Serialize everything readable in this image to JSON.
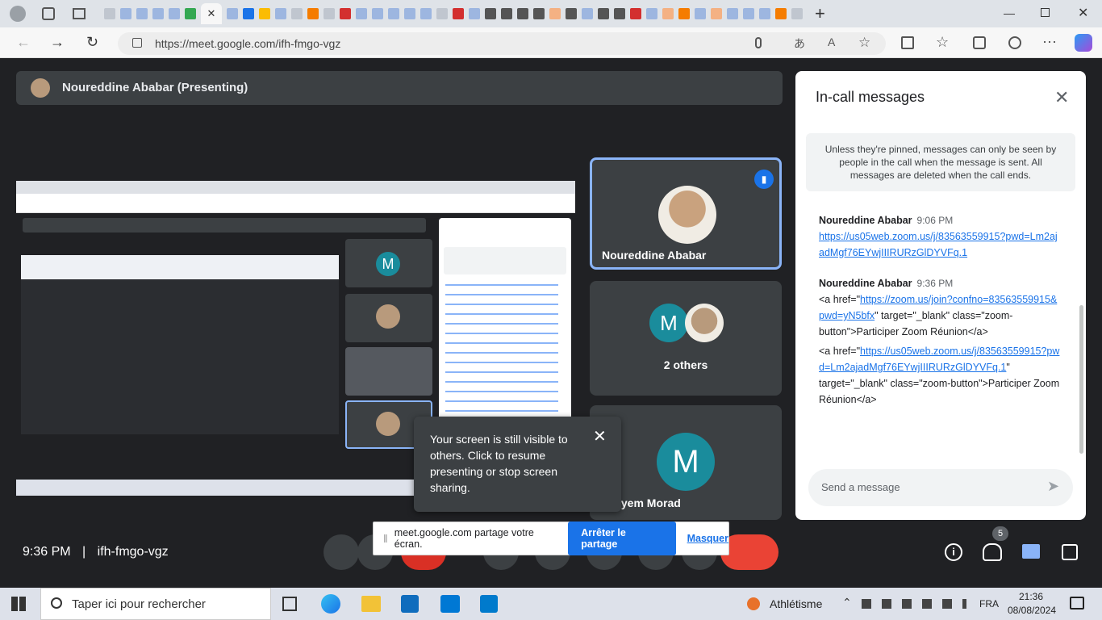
{
  "browser": {
    "url": "https://meet.google.com/ifh-fmgo-vgz"
  },
  "presenter": {
    "name": "Noureddine Ababar (Presenting)"
  },
  "tiles": {
    "t1_name": "Noureddine Ababar",
    "t2_name": "2 others",
    "t2_letter": "M",
    "t3_name": "Meryem Morad",
    "t3_letter": "M"
  },
  "toast": {
    "message": "Your screen is still visible to others. Click to resume presenting or stop screen sharing."
  },
  "sharebar": {
    "text": "meet.google.com partage votre écran.",
    "stop": "Arrêter le partage",
    "hide": "Masquer"
  },
  "meeting": {
    "time": "9:36 PM",
    "code": "ifh-fmgo-vgz",
    "participants": "5"
  },
  "panel": {
    "title": "In-call messages",
    "notice": "Unless they're pinned, messages can only be seen by people in the call when the message is sent. All messages are deleted when the call ends.",
    "messages": [
      {
        "sender": "Noureddine Ababar",
        "time": "9:06 PM",
        "link": "https://us05web.zoom.us/j/83563559915?pwd=Lm2ajadMgf76EYwjIIIRURzGlDYVFq.1"
      },
      {
        "sender": "Noureddine Ababar",
        "time": "9:36 PM",
        "p1_pre": "<a href=\"",
        "p1_link": "https://zoom.us/join?confno=83563559915&pwd=yN5bfx",
        "p1_post": "\" target=\"_blank\" class=\"zoom-button\">Participer Zoom Réunion</a>",
        "p2_pre": "<a href=\"",
        "p2_link": "https://us05web.zoom.us/j/83563559915?pwd=Lm2ajadMgf76EYwjIIIRURzGlDYVFq.1",
        "p2_post": "\" target=\"_blank\" class=\"zoom-button\">Participer Zoom Réunion</a>"
      }
    ],
    "placeholder": "Send a message"
  },
  "taskbar": {
    "search": "Taper ici pour rechercher",
    "weather": "Athlétisme",
    "lang": "FRA",
    "time": "21:36",
    "date": "08/08/2024"
  }
}
